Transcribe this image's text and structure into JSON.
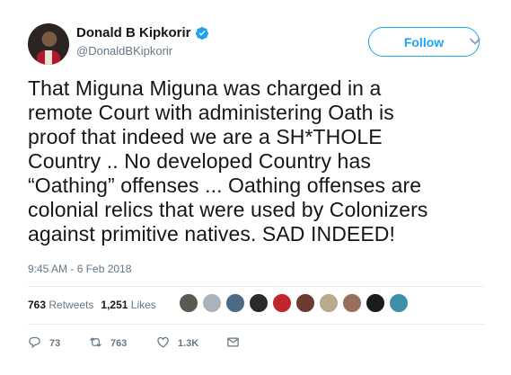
{
  "author": {
    "display_name": "Donald B Kipkorir",
    "handle": "@DonaldBKipkorir",
    "verified": true
  },
  "follow_button": {
    "label": "Follow"
  },
  "tweet": {
    "lines": [
      "That Miguna Miguna was charged in a",
      "remote Court with administering Oath is",
      "proof that indeed we are a SH*THOLE",
      "Country .. No developed Country has",
      "“Oathing” offenses ... Oathing offenses are",
      "colonial relics that were used by Colonizers",
      "against primitive natives. SAD INDEED!"
    ],
    "timestamp": "9:45 AM - 6 Feb 2018"
  },
  "stats": {
    "retweets_count": "763",
    "retweets_label": "Retweets",
    "likes_count": "1,251",
    "likes_label": "Likes"
  },
  "likers": [
    {
      "icon": "liker-avatar",
      "color": "#5a5a52"
    },
    {
      "icon": "liker-avatar",
      "color": "#aab3bb"
    },
    {
      "icon": "liker-avatar",
      "color": "#4b6a86"
    },
    {
      "icon": "liker-avatar",
      "color": "#2a2a2a"
    },
    {
      "icon": "liker-avatar",
      "color": "#c0272d"
    },
    {
      "icon": "liker-avatar",
      "color": "#6b3b30"
    },
    {
      "icon": "liker-avatar",
      "color": "#b9a98d"
    },
    {
      "icon": "liker-avatar",
      "color": "#9a6f5a"
    },
    {
      "icon": "liker-avatar",
      "color": "#1c1c1c"
    },
    {
      "icon": "liker-avatar",
      "color": "#3f8fa8"
    }
  ],
  "actions": {
    "replies": "73",
    "retweets": "763",
    "likes": "1.3K"
  },
  "colors": {
    "accent": "#1da1f2",
    "text": "#14171a",
    "muted": "#657786",
    "divider": "#e6ecf0"
  }
}
